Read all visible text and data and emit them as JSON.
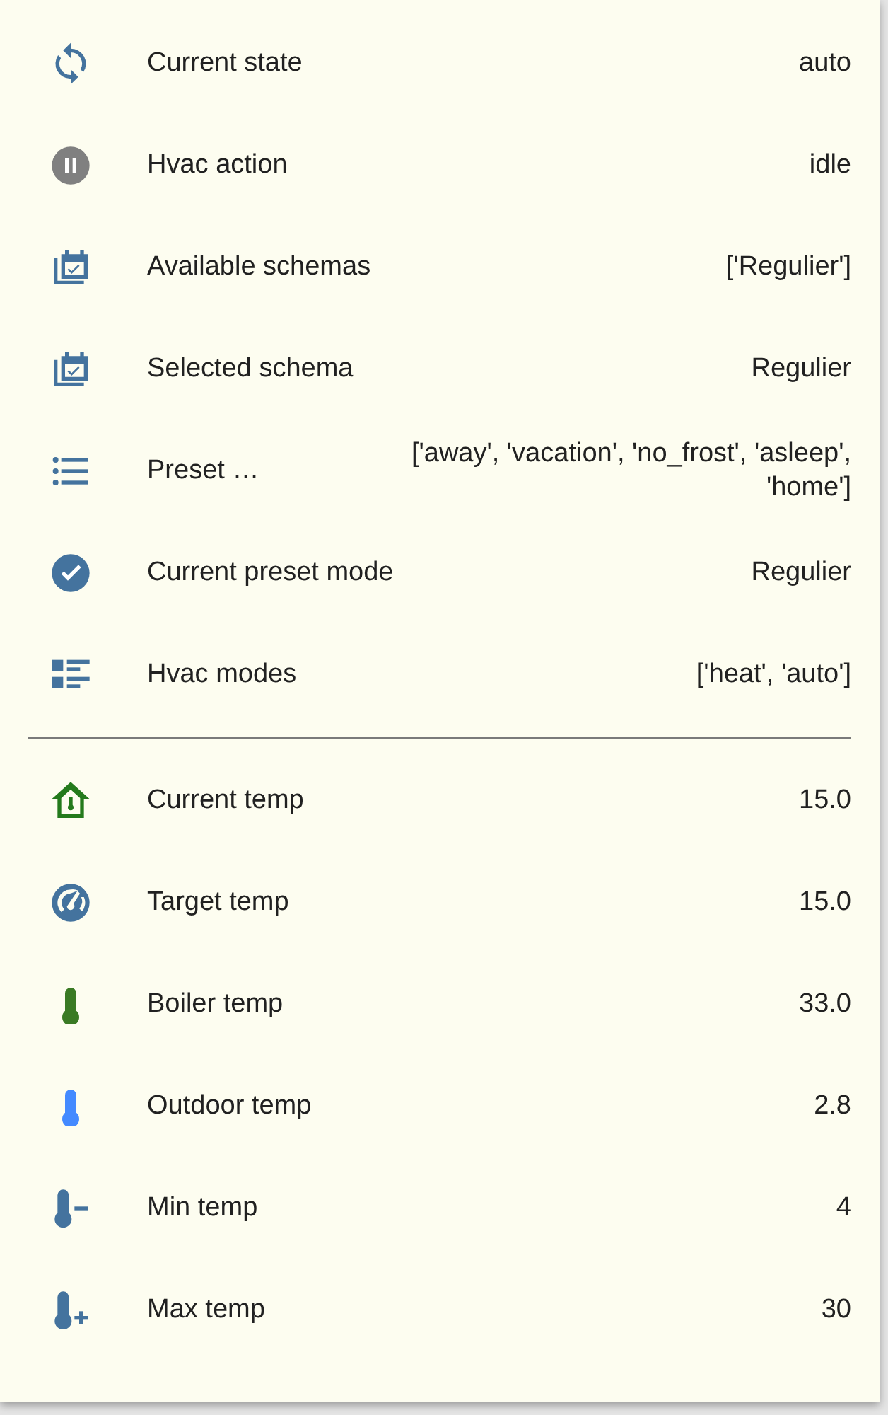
{
  "sections": [
    {
      "rows": [
        {
          "kind": "sync",
          "color": "#44739e",
          "label": "Current state",
          "value": "auto"
        },
        {
          "kind": "pause",
          "color": "#808080",
          "label": "Hvac action",
          "value": "idle"
        },
        {
          "kind": "calendar",
          "color": "#44739e",
          "label": "Available schemas",
          "value": "['Regulier']"
        },
        {
          "kind": "calendar",
          "color": "#44739e",
          "label": "Selected schema",
          "value": "Regulier"
        },
        {
          "kind": "list",
          "color": "#44739e",
          "label": "Preset …",
          "value": "['away', 'vacation', 'no_frost', 'asleep', 'home']"
        },
        {
          "kind": "check",
          "color": "#44739e",
          "label": "Current preset mode",
          "value": "Regulier"
        },
        {
          "kind": "view-list",
          "color": "#44739e",
          "label": "Hvac modes",
          "value": "['heat', 'auto']"
        }
      ]
    },
    {
      "rows": [
        {
          "kind": "home-thermometer",
          "color": "#247a1c",
          "label": "Current temp",
          "value": "15.0"
        },
        {
          "kind": "gauge",
          "color": "#44739e",
          "label": "Target temp",
          "value": "15.0"
        },
        {
          "kind": "thermometer",
          "color": "#3a7a24",
          "label": "Boiler temp",
          "value": "33.0"
        },
        {
          "kind": "thermometer",
          "color": "#448aff",
          "label": "Outdoor temp",
          "value": "2.8"
        },
        {
          "kind": "thermometer-minus",
          "color": "#44739e",
          "label": "Min temp",
          "value": "4"
        },
        {
          "kind": "thermometer-plus",
          "color": "#44739e",
          "label": "Max temp",
          "value": "30"
        }
      ]
    }
  ]
}
